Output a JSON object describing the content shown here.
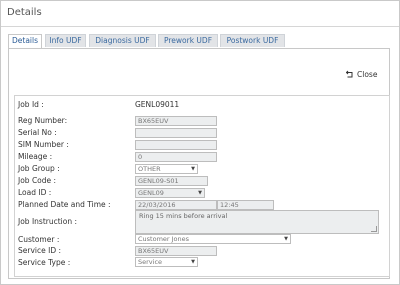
{
  "window": {
    "title": "Details"
  },
  "tabs": [
    "Details",
    "Info UDF",
    "Diagnosis UDF",
    "Prework UDF",
    "Postwork UDF"
  ],
  "close_label": "Close",
  "fields": {
    "job_id": {
      "label": "Job Id :",
      "value": "GENL09011"
    },
    "reg_number": {
      "label": "Reg Number:",
      "value": "BX65EUV"
    },
    "serial_no": {
      "label": "Serial No :",
      "value": ""
    },
    "sim_number": {
      "label": "SIM Number :",
      "value": ""
    },
    "mileage": {
      "label": "Mileage :",
      "value": "0"
    },
    "job_group": {
      "label": "Job Group :",
      "value": "OTHER"
    },
    "job_code": {
      "label": "Job Code :",
      "value": "GENL09-S01"
    },
    "load_id": {
      "label": "Load ID :",
      "value": "GENL09"
    },
    "planned": {
      "label": "Planned Date and Time :",
      "date": "22/03/2016",
      "time": "12:45"
    },
    "job_instruction": {
      "label": "Job Instruction :",
      "value": "Ring 15 mins before arrival"
    },
    "customer": {
      "label": "Customer :",
      "value": "Customer Jones"
    },
    "service_id": {
      "label": "Service ID :",
      "value": "BX65EUV"
    },
    "service_type": {
      "label": "Service Type :",
      "value": "Service"
    }
  }
}
